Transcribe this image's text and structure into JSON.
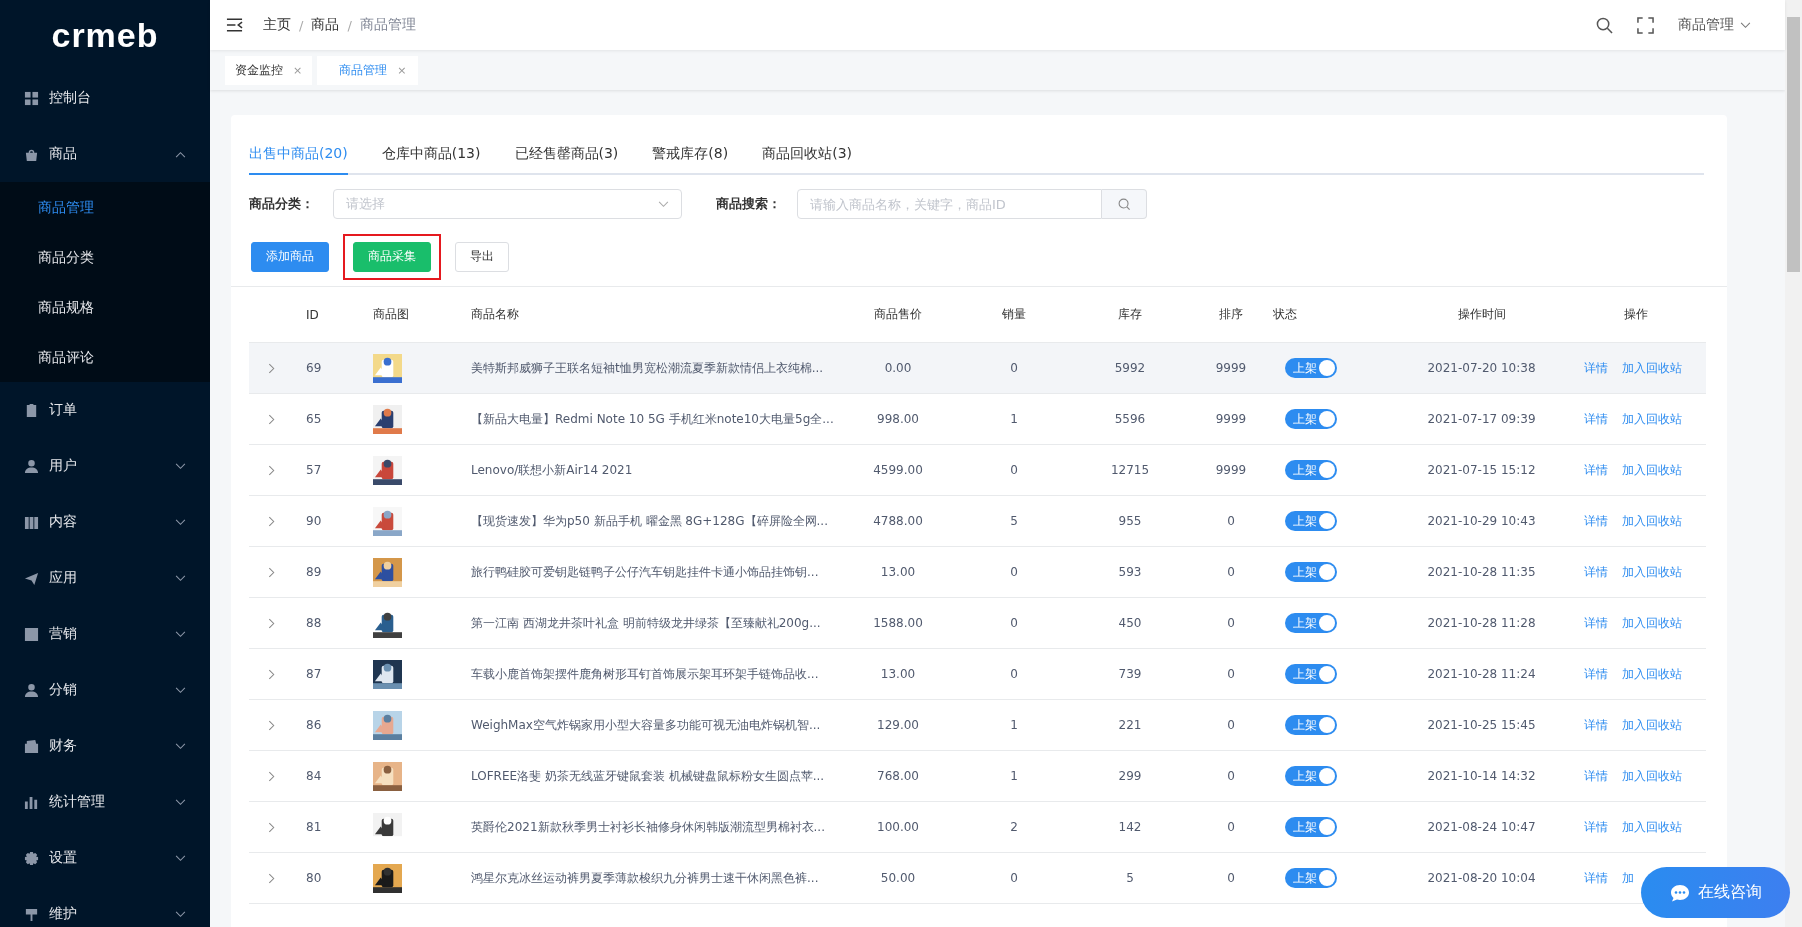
{
  "sidebar": {
    "logo": "crmeb",
    "items": [
      {
        "label": "控制台"
      },
      {
        "label": "商品",
        "expanded": true,
        "children": [
          {
            "label": "商品管理",
            "selected": true
          },
          {
            "label": "商品分类",
            "selected": false
          },
          {
            "label": "商品规格",
            "selected": false
          },
          {
            "label": "商品评论",
            "selected": false
          }
        ]
      },
      {
        "label": "订单"
      },
      {
        "label": "用户",
        "expanded": false
      },
      {
        "label": "内容",
        "expanded": false
      },
      {
        "label": "应用",
        "expanded": false
      },
      {
        "label": "营销",
        "expanded": false
      },
      {
        "label": "分销",
        "expanded": false
      },
      {
        "label": "财务",
        "expanded": false
      },
      {
        "label": "统计管理",
        "expanded": false
      },
      {
        "label": "设置",
        "expanded": false
      },
      {
        "label": "维护",
        "expanded": false
      }
    ]
  },
  "breadcrumb": [
    "主页",
    "商品",
    "商品管理"
  ],
  "breadcrumb_separator": "/",
  "user_menu": "商品管理",
  "page_tags": [
    {
      "label": "资金监控",
      "close": "×",
      "selected": false
    },
    {
      "label": "商品管理",
      "close": "×",
      "selected": true
    }
  ],
  "tabs": [
    {
      "label": "出售中商品(20)",
      "selected": true
    },
    {
      "label": "仓库中商品(13)",
      "selected": false
    },
    {
      "label": "已经售罄商品(3)",
      "selected": false
    },
    {
      "label": "警戒库存(8)",
      "selected": false
    },
    {
      "label": "商品回收站(3)",
      "selected": false
    }
  ],
  "filters": {
    "category_label": "商品分类：",
    "category_placeholder": "请选择",
    "search_label": "商品搜索：",
    "search_placeholder": "请输入商品名称，关键字，商品ID"
  },
  "buttons": [
    {
      "label": "添加商品",
      "kind": "primary"
    },
    {
      "label": "商品采集",
      "kind": "success",
      "highlighted": true
    },
    {
      "label": "导出",
      "kind": "plain"
    }
  ],
  "table": {
    "columns": [
      "ID",
      "商品图",
      "商品名称",
      "商品售价",
      "销量",
      "库存",
      "排序",
      "状态",
      "操作时间",
      "操作"
    ],
    "rows": [
      {
        "id": "69",
        "name": "美特斯邦威狮子王联名短袖t恤男宽松潮流夏季新款情侣上衣纯棉...",
        "price": "0.00",
        "sales": "0",
        "stock": "5992",
        "sort": "9999",
        "status": "上架",
        "on": true,
        "time": "2021-07-20 10:38",
        "actions": [
          "详情",
          "加入回收站"
        ],
        "hovered": true
      },
      {
        "id": "65",
        "name": "【新品大电量】Redmi Note 10 5G 手机红米note10大电量5g全...",
        "price": "998.00",
        "sales": "1",
        "stock": "5596",
        "sort": "9999",
        "status": "上架",
        "on": true,
        "time": "2021-07-17 09:39",
        "actions": [
          "详情",
          "加入回收站"
        ],
        "hovered": false
      },
      {
        "id": "57",
        "name": "Lenovo/联想小新Air14 2021",
        "price": "4599.00",
        "sales": "0",
        "stock": "12715",
        "sort": "9999",
        "status": "上架",
        "on": true,
        "time": "2021-07-15 15:12",
        "actions": [
          "详情",
          "加入回收站"
        ],
        "hovered": false
      },
      {
        "id": "90",
        "name": "【现货速发】华为p50 新品手机 曜金黑 8G+128G【碎屏险全网...",
        "price": "4788.00",
        "sales": "5",
        "stock": "955",
        "sort": "0",
        "status": "上架",
        "on": true,
        "time": "2021-10-29 10:43",
        "actions": [
          "详情",
          "加入回收站"
        ],
        "hovered": false
      },
      {
        "id": "89",
        "name": "旅行鸭硅胶可爱钥匙链鸭子公仔汽车钥匙挂件卡通小饰品挂饰钥...",
        "price": "13.00",
        "sales": "0",
        "stock": "593",
        "sort": "0",
        "status": "上架",
        "on": true,
        "time": "2021-10-28 11:35",
        "actions": [
          "详情",
          "加入回收站"
        ],
        "hovered": false
      },
      {
        "id": "88",
        "name": "第一江南 西湖龙井茶叶礼盒 明前特级龙井绿茶【至臻献礼200g...",
        "price": "1588.00",
        "sales": "0",
        "stock": "450",
        "sort": "0",
        "status": "上架",
        "on": true,
        "time": "2021-10-28 11:28",
        "actions": [
          "详情",
          "加入回收站"
        ],
        "hovered": false
      },
      {
        "id": "87",
        "name": "车载小鹿首饰架摆件鹿角树形耳钉首饰展示架耳环架手链饰品收...",
        "price": "13.00",
        "sales": "0",
        "stock": "739",
        "sort": "0",
        "status": "上架",
        "on": true,
        "time": "2021-10-28 11:24",
        "actions": [
          "详情",
          "加入回收站"
        ],
        "hovered": false
      },
      {
        "id": "86",
        "name": "WeighMax空气炸锅家用小型大容量多功能可视无油电炸锅机智...",
        "price": "129.00",
        "sales": "1",
        "stock": "221",
        "sort": "0",
        "status": "上架",
        "on": true,
        "time": "2021-10-25 15:45",
        "actions": [
          "详情",
          "加入回收站"
        ],
        "hovered": false
      },
      {
        "id": "84",
        "name": "LOFREE洛斐 奶茶无线蓝牙键鼠套装 机械键盘鼠标粉女生圆点苹...",
        "price": "768.00",
        "sales": "1",
        "stock": "299",
        "sort": "0",
        "status": "上架",
        "on": true,
        "time": "2021-10-14 14:32",
        "actions": [
          "详情",
          "加入回收站"
        ],
        "hovered": false
      },
      {
        "id": "81",
        "name": "英爵伦2021新款秋季男士衬衫长袖修身休闲韩版潮流型男棉衬衣...",
        "price": "100.00",
        "sales": "2",
        "stock": "142",
        "sort": "0",
        "status": "上架",
        "on": true,
        "time": "2021-08-24 10:47",
        "actions": [
          "详情",
          "加入回收站"
        ],
        "hovered": false
      },
      {
        "id": "80",
        "name": "鸿星尔克冰丝运动裤男夏季薄款梭织九分裤男士速干休闲黑色裤...",
        "price": "50.00",
        "sales": "0",
        "stock": "5",
        "sort": "0",
        "status": "上架",
        "on": true,
        "time": "2021-08-20 10:04",
        "actions": [
          "详情",
          "加"
        ],
        "hovered": false
      }
    ]
  },
  "chat_button": "在线咨询"
}
